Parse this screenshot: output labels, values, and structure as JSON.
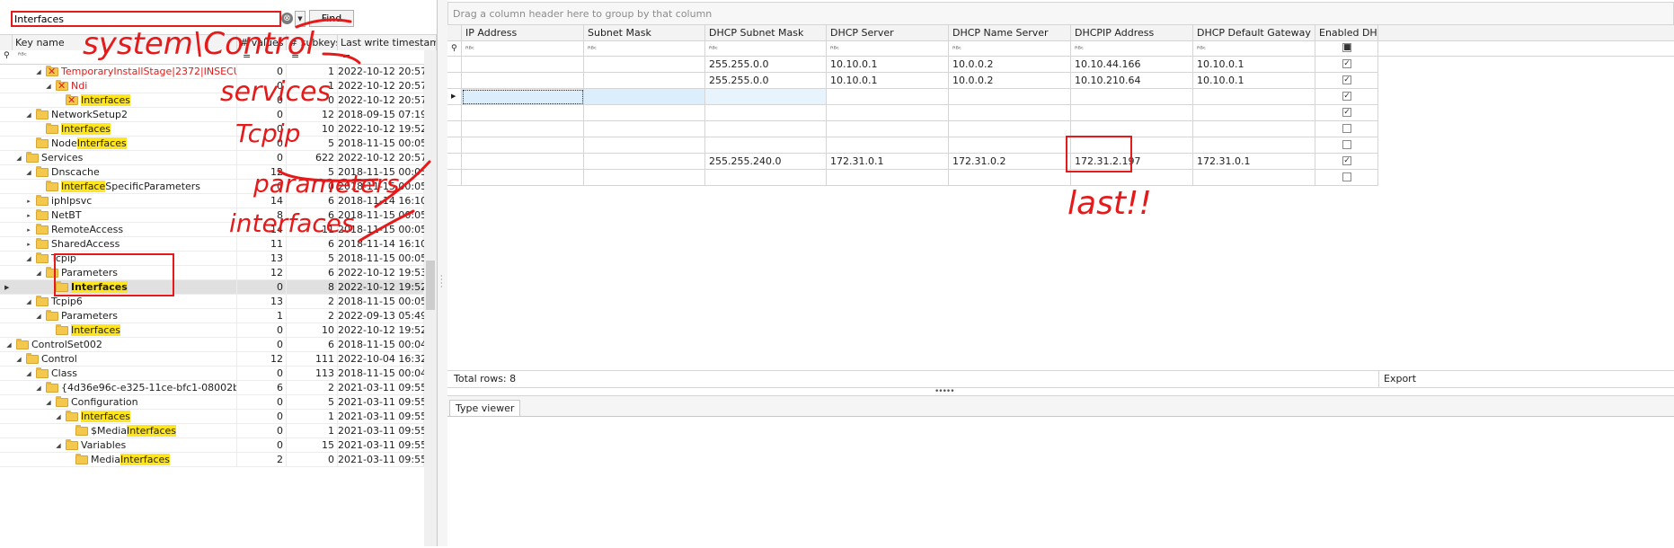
{
  "search": {
    "value": "Interfaces",
    "clear_glyph": "⊗",
    "find_label": "Find",
    "dropdown_glyph": "▼"
  },
  "tree_header": {
    "key_name": "Key name",
    "values": "# values",
    "subkeys": "# subkeys",
    "timestamp": "Last write timestamp"
  },
  "filter_glyph": "ᴿᴮᶜ",
  "filter_eq": "=",
  "tree_rows": [
    {
      "level": 6,
      "expander": "◢",
      "icon": "deleted",
      "name_parts": [
        {
          "t": "TemporaryInstallStage|2372|INSECU...",
          "red": true
        }
      ],
      "values": "0",
      "subkeys": "1",
      "ts": "2022-10-12 20:57:27"
    },
    {
      "level": 7,
      "expander": "◢",
      "icon": "deleted",
      "name_parts": [
        {
          "t": "Ndi",
          "red": true
        }
      ],
      "values": "0",
      "subkeys": "1",
      "ts": "2022-10-12 20:57:27"
    },
    {
      "level": 8,
      "expander": "",
      "icon": "deleted",
      "name_parts": [
        {
          "t": "Interfaces",
          "hl": true
        }
      ],
      "values": "0",
      "subkeys": "0",
      "ts": "2022-10-12 20:57:27"
    },
    {
      "level": 5,
      "expander": "◢",
      "icon": "folder",
      "name_parts": [
        {
          "t": "NetworkSetup2"
        }
      ],
      "values": "0",
      "subkeys": "12",
      "ts": "2018-09-15 07:19:21"
    },
    {
      "level": 6,
      "expander": "",
      "icon": "folder",
      "name_parts": [
        {
          "t": "Interfaces",
          "hl": true
        }
      ],
      "values": "0",
      "subkeys": "10",
      "ts": "2022-10-12 19:52:36"
    },
    {
      "level": 5,
      "expander": "",
      "icon": "folder",
      "name_parts": [
        {
          "t": "Node"
        },
        {
          "t": "Interfaces",
          "hl": true
        }
      ],
      "values": "0",
      "subkeys": "5",
      "ts": "2018-11-15 00:05:36"
    },
    {
      "level": 4,
      "expander": "◢",
      "icon": "folder",
      "name_parts": [
        {
          "t": "Services"
        }
      ],
      "values": "0",
      "subkeys": "622",
      "ts": "2022-10-12 20:57:27"
    },
    {
      "level": 5,
      "expander": "◢",
      "icon": "folder",
      "name_parts": [
        {
          "t": "Dnscache"
        }
      ],
      "values": "12",
      "subkeys": "5",
      "ts": "2018-11-15 00:05:36"
    },
    {
      "level": 6,
      "expander": "",
      "icon": "folder",
      "name_parts": [
        {
          "t": "Interface",
          "hl": true
        },
        {
          "t": "SpecificParameters"
        }
      ],
      "values": "0",
      "subkeys": "0",
      "ts": "2018-11-15 00:05:36"
    },
    {
      "level": 5,
      "expander": "▸",
      "icon": "folder",
      "name_parts": [
        {
          "t": "iphlpsvc"
        }
      ],
      "values": "14",
      "subkeys": "6",
      "ts": "2018-11-14 16:10:19"
    },
    {
      "level": 5,
      "expander": "▸",
      "icon": "folder",
      "name_parts": [
        {
          "t": "NetBT"
        }
      ],
      "values": "8",
      "subkeys": "6",
      "ts": "2018-11-15 00:05:36"
    },
    {
      "level": 5,
      "expander": "▸",
      "icon": "folder",
      "name_parts": [
        {
          "t": "RemoteAccess"
        }
      ],
      "values": "14",
      "subkeys": "11",
      "ts": "2018-11-15 00:05:36"
    },
    {
      "level": 5,
      "expander": "▸",
      "icon": "folder",
      "name_parts": [
        {
          "t": "SharedAccess"
        }
      ],
      "values": "11",
      "subkeys": "6",
      "ts": "2018-11-14 16:10:42"
    },
    {
      "level": 5,
      "expander": "◢",
      "icon": "folder",
      "name_parts": [
        {
          "t": "Tcpip"
        }
      ],
      "values": "13",
      "subkeys": "5",
      "ts": "2018-11-15 00:05:36"
    },
    {
      "level": 6,
      "expander": "◢",
      "icon": "folder",
      "name_parts": [
        {
          "t": "Parameters"
        }
      ],
      "values": "12",
      "subkeys": "6",
      "ts": "2022-10-12 19:53:05"
    },
    {
      "level": 7,
      "expander": "",
      "icon": "folder",
      "name_parts": [
        {
          "t": "Interfaces",
          "hl": true,
          "bold": true
        }
      ],
      "values": "0",
      "subkeys": "8",
      "ts": "2022-10-12 19:52:36",
      "selected": true
    },
    {
      "level": 5,
      "expander": "◢",
      "icon": "folder",
      "name_parts": [
        {
          "t": "Tcpip6"
        }
      ],
      "values": "13",
      "subkeys": "2",
      "ts": "2018-11-15 00:05:36"
    },
    {
      "level": 6,
      "expander": "◢",
      "icon": "folder",
      "name_parts": [
        {
          "t": "Parameters"
        }
      ],
      "values": "1",
      "subkeys": "2",
      "ts": "2022-09-13 05:49:50"
    },
    {
      "level": 7,
      "expander": "",
      "icon": "folder",
      "name_parts": [
        {
          "t": "Interfaces",
          "hl": true
        }
      ],
      "values": "0",
      "subkeys": "10",
      "ts": "2022-10-12 19:52:36"
    },
    {
      "level": 3,
      "expander": "◢",
      "icon": "folder",
      "name_parts": [
        {
          "t": "ControlSet002"
        }
      ],
      "values": "0",
      "subkeys": "6",
      "ts": "2018-11-15 00:04:07"
    },
    {
      "level": 4,
      "expander": "◢",
      "icon": "folder",
      "name_parts": [
        {
          "t": "Control"
        }
      ],
      "values": "12",
      "subkeys": "111",
      "ts": "2022-10-04 16:32:22"
    },
    {
      "level": 5,
      "expander": "◢",
      "icon": "folder",
      "name_parts": [
        {
          "t": "Class"
        }
      ],
      "values": "0",
      "subkeys": "113",
      "ts": "2018-11-15 00:04:04"
    },
    {
      "level": 6,
      "expander": "◢",
      "icon": "folder",
      "name_parts": [
        {
          "t": "{4d36e96c-e325-11ce-bfc1-08002be..."
        }
      ],
      "values": "6",
      "subkeys": "2",
      "ts": "2021-03-11 09:55:38"
    },
    {
      "level": 7,
      "expander": "◢",
      "icon": "folder",
      "name_parts": [
        {
          "t": "Configuration"
        }
      ],
      "values": "0",
      "subkeys": "5",
      "ts": "2021-03-11 09:55:38"
    },
    {
      "level": 8,
      "expander": "◢",
      "icon": "folder",
      "name_parts": [
        {
          "t": "Interfaces",
          "hl": true
        }
      ],
      "values": "0",
      "subkeys": "1",
      "ts": "2021-03-11 09:55:38"
    },
    {
      "level": 9,
      "expander": "",
      "icon": "folder",
      "name_parts": [
        {
          "t": "$Media"
        },
        {
          "t": "Interfaces",
          "hl": true
        }
      ],
      "values": "0",
      "subkeys": "1",
      "ts": "2021-03-11 09:55:38"
    },
    {
      "level": 8,
      "expander": "◢",
      "icon": "folder",
      "name_parts": [
        {
          "t": "Variables"
        }
      ],
      "values": "0",
      "subkeys": "15",
      "ts": "2021-03-11 09:55:38"
    },
    {
      "level": 9,
      "expander": "",
      "icon": "folder",
      "name_parts": [
        {
          "t": "Media"
        },
        {
          "t": "Interfaces",
          "hl": true
        }
      ],
      "values": "2",
      "subkeys": "0",
      "ts": "2021-03-11 09:55:38"
    }
  ],
  "group_panel_hint": "Drag a column header here to group by that column",
  "grid_columns": [
    "IP Address",
    "Subnet Mask",
    "DHCP Subnet Mask",
    "DHCP Server",
    "DHCP Name Server",
    "DHCPIP Address",
    "DHCP Default Gateway",
    "Enabled DHCP"
  ],
  "grid_rows": [
    {
      "cells": [
        "",
        "",
        "255.255.0.0",
        "10.10.0.1",
        "10.0.0.2",
        "10.10.44.166",
        "10.10.0.1"
      ],
      "enabled": true
    },
    {
      "cells": [
        "",
        "",
        "255.255.0.0",
        "10.10.0.1",
        "10.0.0.2",
        "10.10.210.64",
        "10.10.0.1"
      ],
      "enabled": true
    },
    {
      "cells": [
        "",
        "",
        "",
        "",
        "",
        "",
        ""
      ],
      "enabled": true,
      "current": true
    },
    {
      "cells": [
        "",
        "",
        "",
        "",
        "",
        "",
        ""
      ],
      "enabled": true
    },
    {
      "cells": [
        "",
        "",
        "",
        "",
        "",
        "",
        ""
      ],
      "enabled": false
    },
    {
      "cells": [
        "",
        "",
        "",
        "",
        "",
        "",
        ""
      ],
      "enabled": false
    },
    {
      "cells": [
        "",
        "",
        "255.255.240.0",
        "172.31.0.1",
        "172.31.0.2",
        "172.31.2.197",
        "172.31.0.1"
      ],
      "enabled": true
    },
    {
      "cells": [
        "",
        "",
        "",
        "",
        "",
        "",
        ""
      ],
      "enabled": false
    }
  ],
  "footer": {
    "total_rows": "Total rows: 8",
    "export": "Export"
  },
  "splitter_dots": "•••••",
  "lower_tab": "Type viewer",
  "colors": {
    "accent_red": "#e51a1a",
    "highlight_yellow": "#ffe51e",
    "folder": "#f4c74d"
  },
  "annotations": {
    "path_line1": "system\\Control",
    "path_line2": "services",
    "path_line3": "Tcpip",
    "path_line4": "parameters",
    "path_line5": "interfaces",
    "last_note": "last!!"
  }
}
